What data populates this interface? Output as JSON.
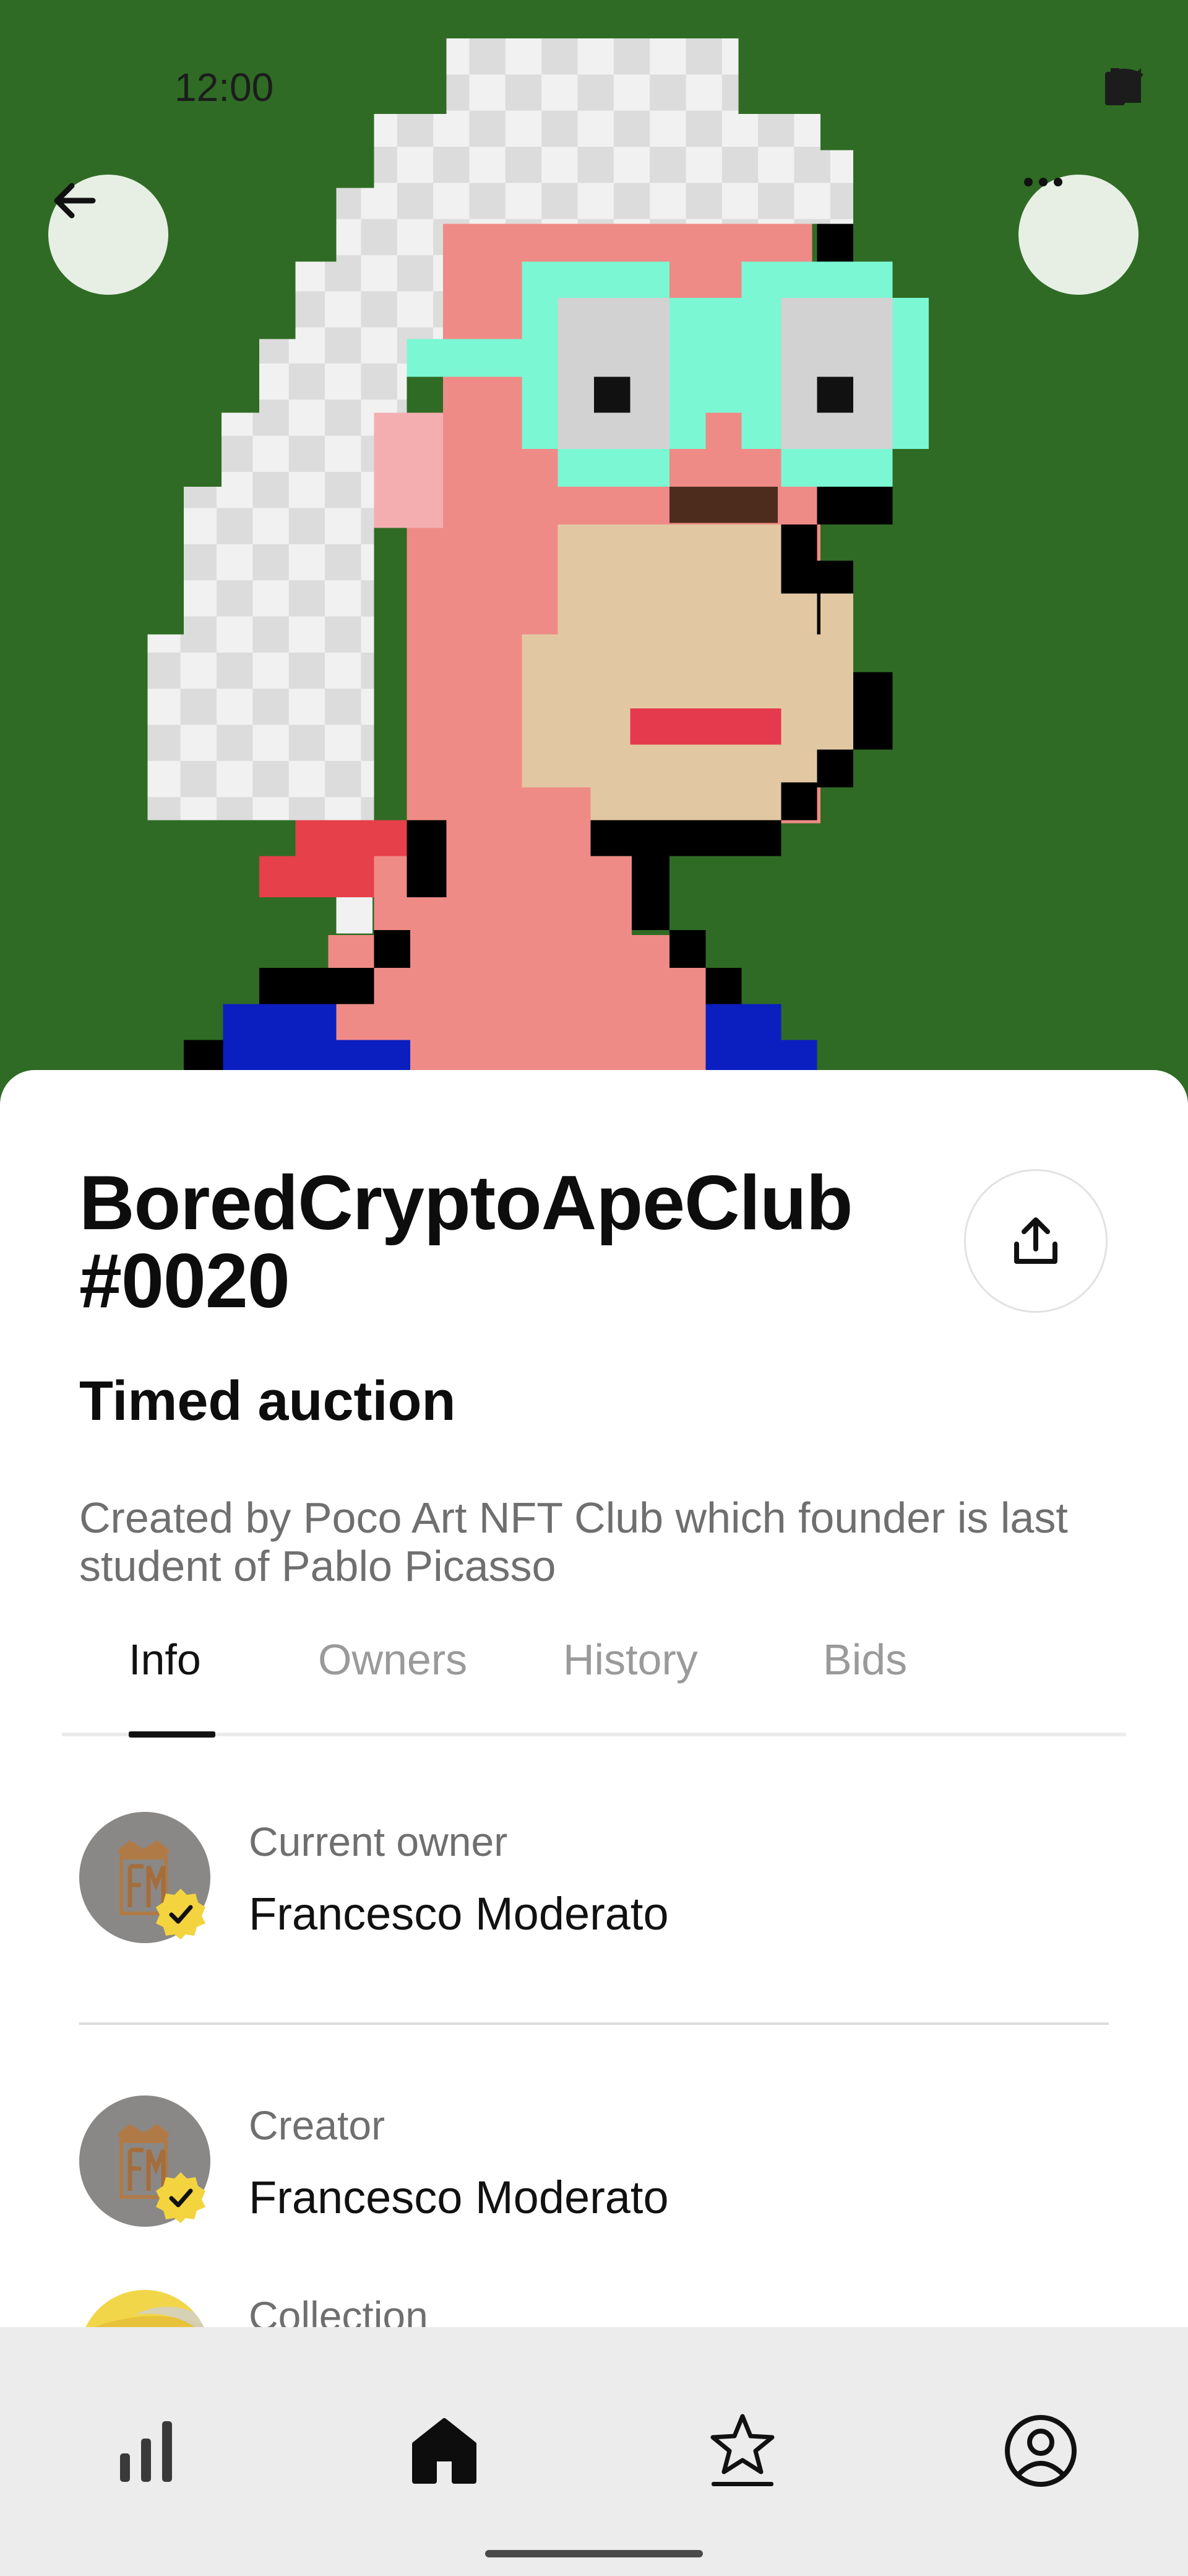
{
  "status_bar": {
    "time": "12:00"
  },
  "header": {
    "back_icon": "arrow-left-icon",
    "more_icon": "more-horizontal-icon"
  },
  "nft": {
    "title": "BoredCryptoApeClub #0020",
    "sale_type": "Timed auction",
    "description": "Created by Poco Art NFT Club which founder is last student of Pablo Picasso",
    "share_icon": "share-icon"
  },
  "tabs": [
    {
      "label": "Info",
      "active": true
    },
    {
      "label": "Owners",
      "active": false
    },
    {
      "label": "History",
      "active": false
    },
    {
      "label": "Bids",
      "active": false
    }
  ],
  "info": {
    "current_owner": {
      "label": "Current owner",
      "name": "Francesco Moderato",
      "verified": true
    },
    "creator": {
      "label": "Creator",
      "name": "Francesco Moderato",
      "verified": true
    },
    "collection": {
      "label": "Collection"
    }
  },
  "bottom_nav": [
    {
      "icon": "stats-icon",
      "active": false
    },
    {
      "icon": "home-icon",
      "active": true
    },
    {
      "icon": "favorites-icon",
      "active": false
    },
    {
      "icon": "profile-icon",
      "active": false
    }
  ],
  "colors": {
    "hero_background": "#2f6b24",
    "verified_badge": "#f3d43e",
    "sheet_background": "#ffffff",
    "nav_background": "#ececec"
  }
}
